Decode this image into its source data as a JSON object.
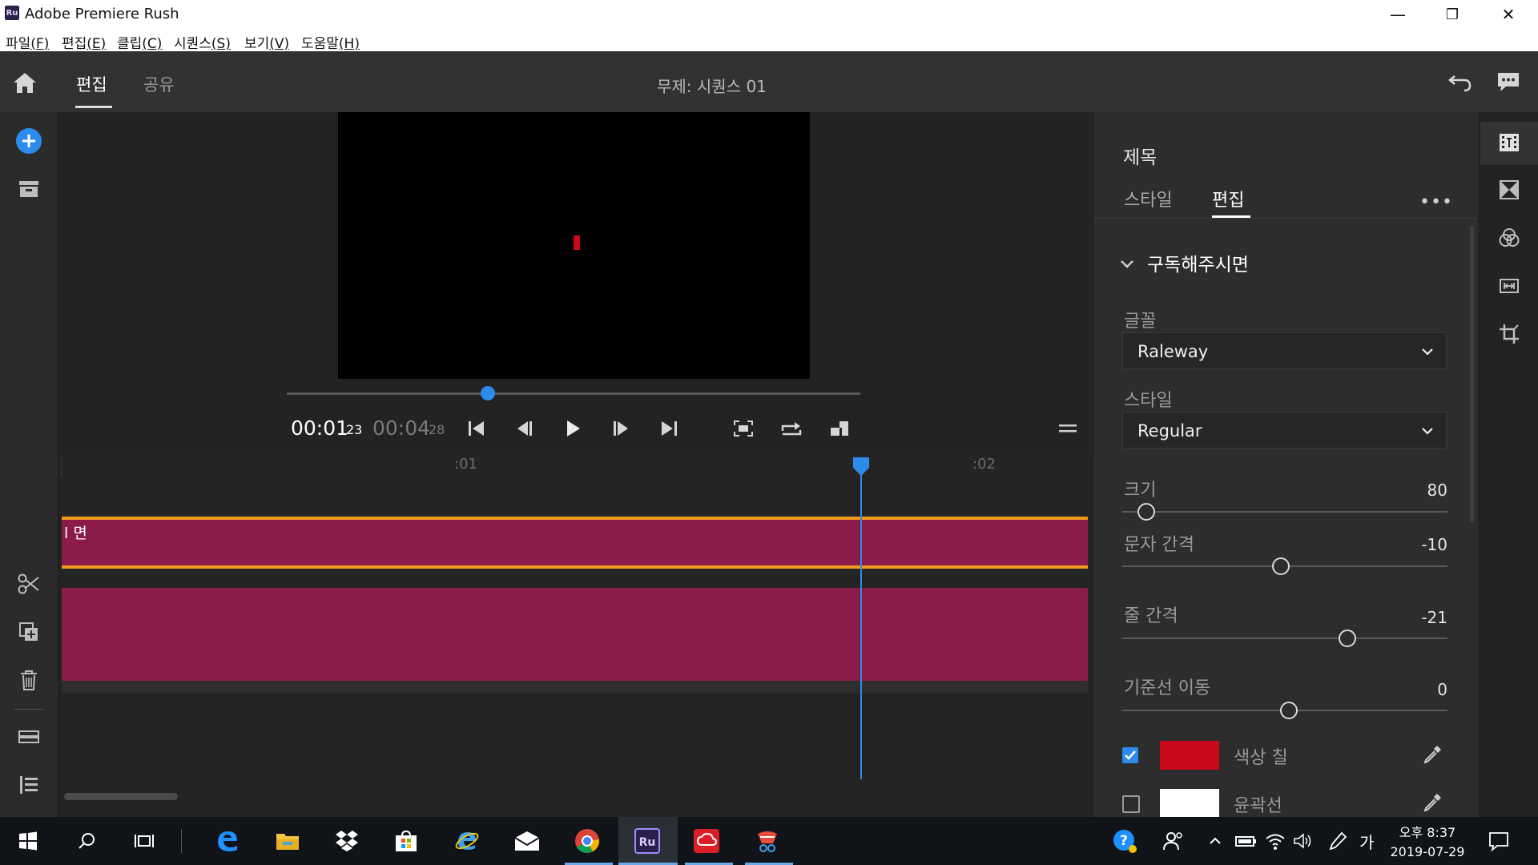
{
  "window": {
    "app_logo": "Ru",
    "title": "Adobe Premiere Rush",
    "controls": {
      "minimize": "—",
      "restore": "❐",
      "close": "✕"
    }
  },
  "menu": [
    {
      "label": "파일",
      "key": "(F)"
    },
    {
      "label": "편집",
      "key": "(E)"
    },
    {
      "label": "클립",
      "key": "(C)"
    },
    {
      "label": "시퀀스",
      "key": "(S)"
    },
    {
      "label": "보기",
      "key": "(V)"
    },
    {
      "label": "도움말",
      "key": "(H)"
    }
  ],
  "header": {
    "tabs": {
      "edit": "편집",
      "share": "공유"
    },
    "sequence_title": "무제: 시퀀스 01"
  },
  "player": {
    "current": "00:01",
    "current_frames": "23",
    "duration": "00:04",
    "duration_frames": "28",
    "progress": 0.35
  },
  "timeline": {
    "ruler": [
      ":01",
      ":02"
    ],
    "title_clip_label": "l 면"
  },
  "panel": {
    "title": "제목",
    "tabs": {
      "style": "스타일",
      "edit": "편집"
    },
    "more": "•••",
    "section_title": "구독해주시면",
    "font_label": "글꼴",
    "font_value": "Raleway",
    "style_label": "스타일",
    "style_value": "Regular",
    "size": {
      "label": "크기",
      "value": "80"
    },
    "tracking": {
      "label": "문자 간격",
      "value": "-10"
    },
    "leading": {
      "label": "줄 간격",
      "value": "-21"
    },
    "baseline": {
      "label": "기준선 이동",
      "value": "0"
    },
    "fill": {
      "label": "색상 칠",
      "checked": true,
      "color": "#c80a1a"
    },
    "outline": {
      "label": "윤곽선",
      "checked": false,
      "color": "#ffffff"
    }
  },
  "taskbar": {
    "clock_time": "오후 8:37",
    "clock_date": "2019-07-29",
    "ime": "가"
  },
  "colors": {
    "accent": "#2d8ceb",
    "clip": "#8a1b4b",
    "clip_border": "#f29a1d"
  }
}
